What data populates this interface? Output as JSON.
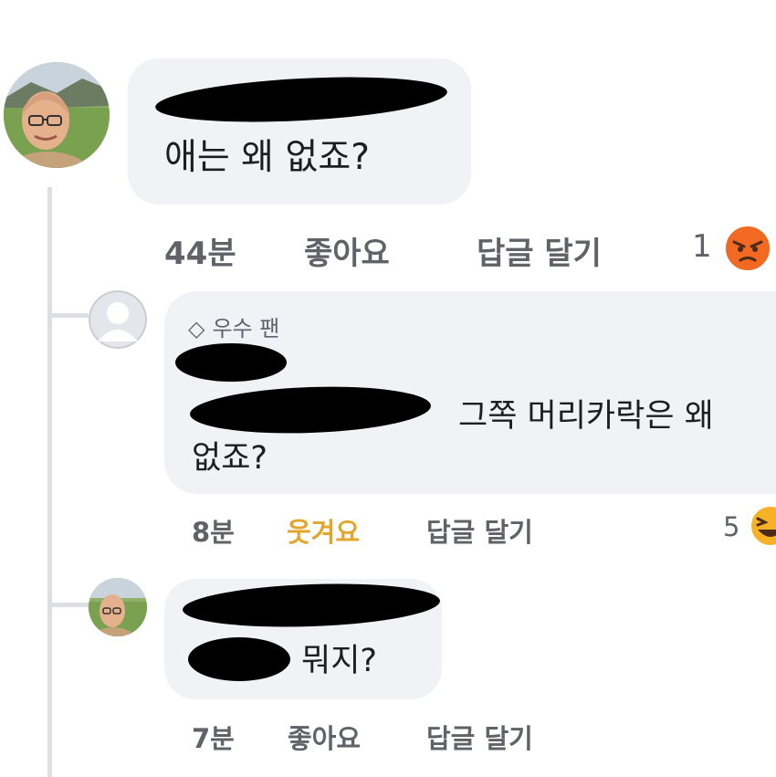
{
  "comments": [
    {
      "author": "",
      "text": "애는 왜 없죠?",
      "time": "44분",
      "action_label": "좋아요",
      "reply_label": "답글 달기",
      "reaction_count": "1",
      "reaction_icon": "angry-reaction-icon"
    },
    {
      "badge_label": "우수 팬",
      "author": "",
      "mention": "",
      "text_line1": "그쪽 머리카락은 왜",
      "text_line2": "없죠?",
      "time": "8분",
      "action_label": "웃겨요",
      "action_color": "#e3a62d",
      "reply_label": "답글 달기",
      "reaction_count": "5",
      "reaction_icon": "haha-reaction-icon"
    },
    {
      "author": "",
      "mention": "",
      "text": "뭐지?",
      "time": "7분",
      "action_label": "좋아요",
      "reply_label": "답글 달기"
    }
  ],
  "colors": {
    "bubble": "#f0f2f5",
    "meta_text": "#5f6368",
    "mention_link": "#1877f2",
    "reacted_action": "#e3a62d",
    "angry_reaction": "#f26a22",
    "haha_reaction": "#f7b125"
  }
}
